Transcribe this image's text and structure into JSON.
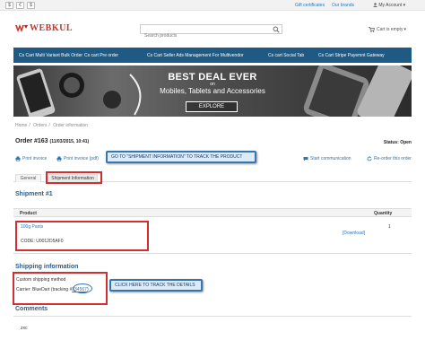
{
  "topbar": {
    "currency_1": "$",
    "currency_2": "€",
    "currency_3": "$",
    "gift_certificates": "Gift certificates",
    "our_brands": "Our brands",
    "my_account": "My Account"
  },
  "header": {
    "logo_text": "WEBKUL",
    "search_placeholder": "Search products",
    "cart_label": "Cart is empty"
  },
  "nav": {
    "items": [
      "Cs Cart Multi Variant Bulk Order",
      "Cs cart Pre order",
      "Cs Cart Seller Ads Management For Multivendor",
      "Cs cart Social Tab",
      "Cs Cart Stripe Payemnt Gateway"
    ]
  },
  "banner": {
    "line1": "BEST DEAL EVER",
    "line2": "on",
    "line3": "Mobiles, Tablets and Accessories",
    "button": "EXPLORE"
  },
  "breadcrumb": {
    "home": "Home",
    "orders": "Orders",
    "current": "Order information"
  },
  "order": {
    "title": "Order #163",
    "date": "(11/03/2015, 10:41)",
    "status": "Status: Open"
  },
  "actions": {
    "print_invoice": "Print invoice",
    "print_invoice_pdf": "Print invoice (pdf)",
    "start_communication": "Start communication",
    "reorder": "Re-order this order"
  },
  "tabs": {
    "general": "General",
    "shipment_information": "Shipment Information"
  },
  "shipment": {
    "title": "Shipment #1",
    "col_product": "Product",
    "col_quantity": "Quantity",
    "product_name": "100g Pants",
    "product_code": "CODE: U0012D5AF0",
    "download": "[Download]",
    "quantity": "1"
  },
  "shipping_info": {
    "title": "Shipping information",
    "method": "Custom shipping method",
    "carrier_prefix": "Carrier: BlueDart (tracking #",
    "tracking_number": "234567",
    "carrier_suffix": ")"
  },
  "comments": {
    "title": "Comments",
    "text": "zxc"
  },
  "annotations": {
    "callout_tab": "GO TO \"SHIPMENT INFORMATION\" TO TRACK THE PRODUCT",
    "callout_track": "CLICK HERE TO TRACK THE DETAILS"
  },
  "colors": {
    "nav_bg": "#1f5a85",
    "brand_red": "#c4352a",
    "link": "#2a78b8",
    "annotation_red": "#d23030",
    "callout_border": "#3577b3"
  }
}
